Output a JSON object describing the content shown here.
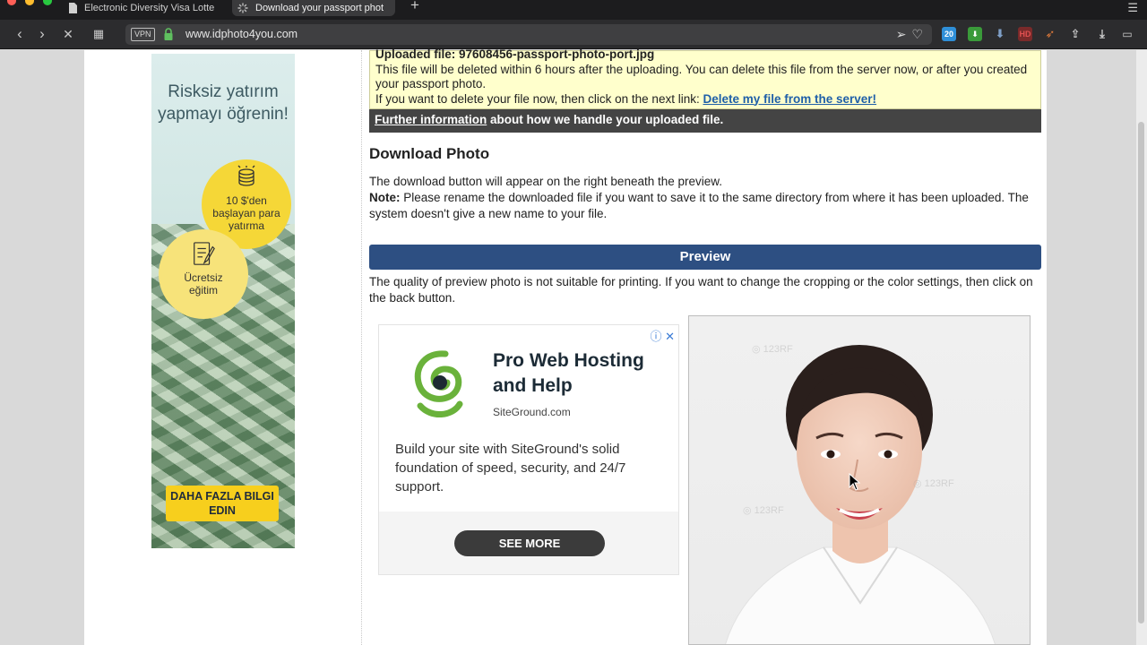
{
  "browser": {
    "tabs": [
      {
        "title": "Electronic Diversity Visa Lotte",
        "active": false
      },
      {
        "title": "Download your passport phot",
        "active": true
      }
    ],
    "vpn_label": "VPN",
    "url": "www.idphoto4you.com",
    "ext_badge": "20",
    "ext_hd": "HD"
  },
  "ad_left": {
    "headline": "Risksiz yatırım yapmayı öğrenin!",
    "bubble1": "10 $'den başlayan para yatırma",
    "bubble2": "Ücretsiz eğitim",
    "cta": "DAHA FAZLA BILGI EDIN"
  },
  "upload_info": {
    "filename_line": "Uploaded file: 97608456-passport-photo-port.jpg",
    "line1": "This file will be deleted within 6 hours after the uploading. You can delete this file from the server now, or after you created your passport photo.",
    "line2_prefix": "If you want to delete your file now, then click on the next link: ",
    "delete_link": "Delete my file from the server!",
    "further_link": "Further information",
    "further_suffix": " about how we handle your uploaded file."
  },
  "download": {
    "heading": "Download Photo",
    "text1": "The download button will appear on the right beneath the preview.",
    "note_label": "Note:",
    "note_text": " Please rename the downloaded file if you want to save it to the same directory from where it has been uploaded. The system doesn't give a new name to your file."
  },
  "preview": {
    "bar_label": "Preview",
    "text": "The quality of preview photo is not suitable for printing. If you want to change the cropping or the color settings, then click on the back button."
  },
  "ad_center": {
    "title": "Pro Web Hosting and Help",
    "domain": "SiteGround.com",
    "body": "Build your site with SiteGround's solid foundation of speed, security, and 24/7 support.",
    "button": "SEE MORE"
  },
  "colors": {
    "preview_bar": "#2d4f82",
    "info_bg": "#ffffcc",
    "link": "#1f5fa8",
    "siteground_green": "#6ab23b"
  }
}
